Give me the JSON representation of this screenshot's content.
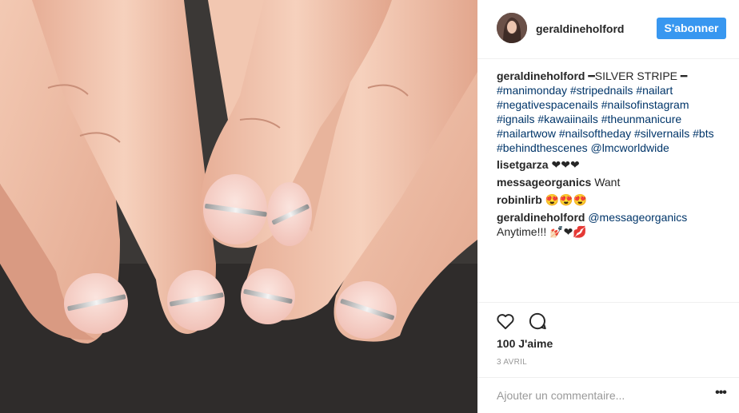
{
  "post": {
    "username": "geraldineholford",
    "follow_label": "S'abonner",
    "photo_icon": "nail-art-photo"
  },
  "caption": {
    "author": "geraldineholford",
    "title": "━SILVER STRIPE ━",
    "lines": [
      "#manimonday #stripednails #nailart",
      "#negativespacenails #nailsofinstagram",
      "#ignails #kawaiinails #theunmanicure",
      "#nailartwow #nailsoftheday #silvernails #bts",
      "#behindthescenes @lmcworldwide"
    ]
  },
  "comments": [
    {
      "author": "lisetgarza",
      "text": "❤❤❤"
    },
    {
      "author": "messageorganics",
      "text": "Want"
    },
    {
      "author": "robinlirb",
      "text": "😍😍😍"
    },
    {
      "author": "geraldineholford",
      "mention": "@messageorganics",
      "text": "Anytime!!! 💅🏻❤💋"
    }
  ],
  "actions": {
    "like_icon": "heart-icon",
    "comment_icon": "comment-bubble-icon",
    "likes_label": "100 J'aime",
    "date": "3 AVRIL"
  },
  "add_comment": {
    "placeholder": "Ajouter un commentaire...",
    "more_label": "•••"
  },
  "colors": {
    "accent": "#3897f0",
    "hashtag": "#003569",
    "muted": "#999999",
    "text": "#262626"
  }
}
